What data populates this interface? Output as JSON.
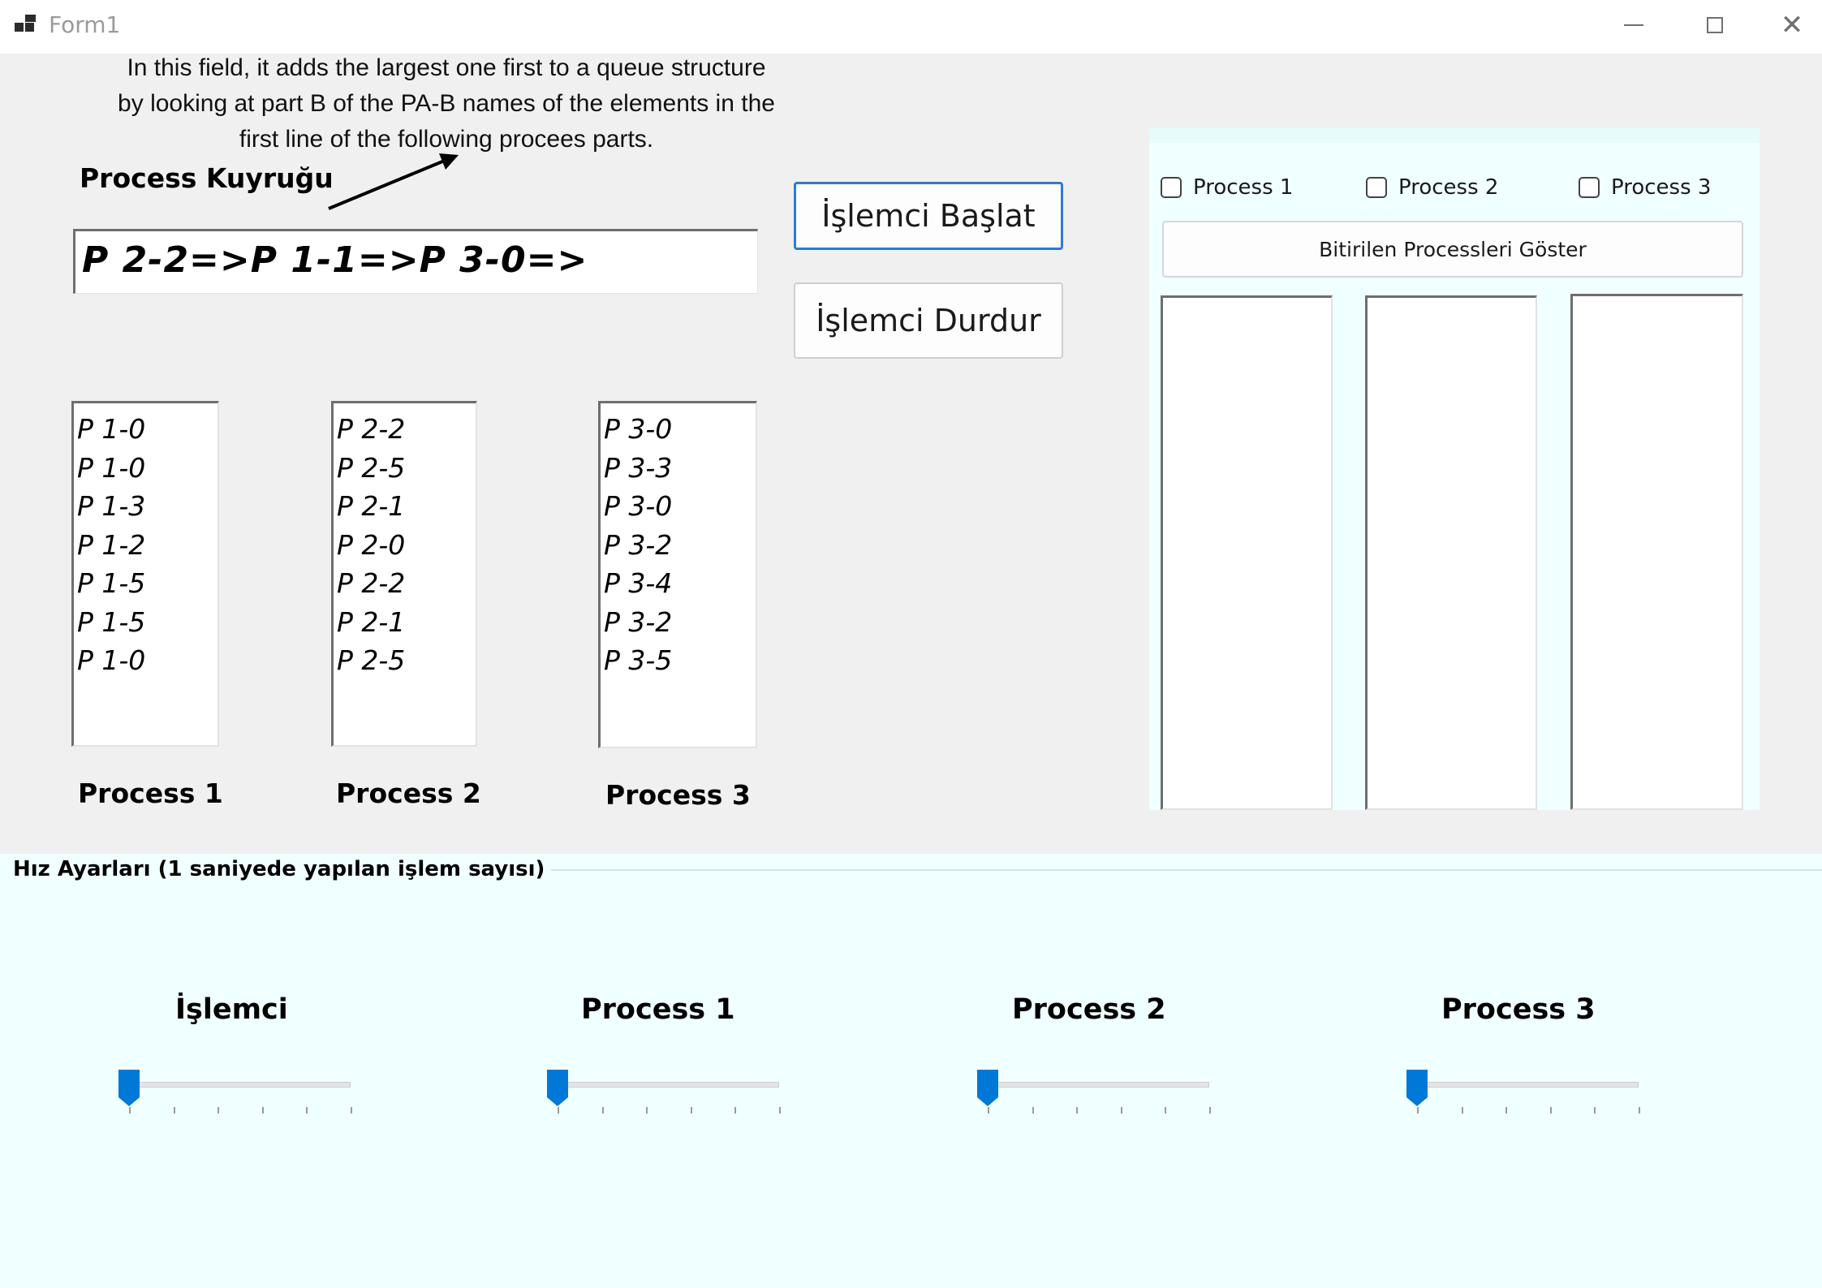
{
  "window": {
    "title": "Form1"
  },
  "annotation": "In this field, it adds the largest one first to a queue structure by looking at part B of the PA-B names of the elements in the first line of the following procees parts.",
  "queue": {
    "label": "Process Kuyruğu",
    "value": "P 2-2=>P 1-1=>P 3-0=>"
  },
  "buttons": {
    "start": "İşlemci Başlat",
    "stop": "İşlemci Durdur",
    "show_finished": "Bitirilen Processleri Göster"
  },
  "processes": [
    {
      "label": "Process 1",
      "items": [
        "P 1-0",
        "P 1-0",
        "P 1-3",
        "P 1-2",
        "P 1-5",
        "P 1-5",
        "P 1-0"
      ]
    },
    {
      "label": "Process 2",
      "items": [
        "P 2-2",
        "P 2-5",
        "P 2-1",
        "P 2-0",
        "P 2-2",
        "P 2-1",
        "P 2-5"
      ]
    },
    {
      "label": "Process 3",
      "items": [
        "P 3-0",
        "P 3-3",
        "P 3-0",
        "P 3-2",
        "P 3-4",
        "P 3-2",
        "P 3-5"
      ]
    }
  ],
  "checkboxes": [
    {
      "label": "Process 1",
      "checked": false
    },
    {
      "label": "Process 2",
      "checked": false
    },
    {
      "label": "Process 3",
      "checked": false
    }
  ],
  "speed": {
    "group_title": "Hız Ayarları (1 saniyede yapılan işlem sayısı)",
    "sliders": [
      {
        "label": "İşlemci",
        "value": 0,
        "max": 5
      },
      {
        "label": "Process 1",
        "value": 0,
        "max": 5
      },
      {
        "label": "Process 2",
        "value": 0,
        "max": 5
      },
      {
        "label": "Process 3",
        "value": 0,
        "max": 5
      }
    ]
  },
  "colors": {
    "accent": "#0078d7",
    "panel_bg": "#f0ffff",
    "window_bg": "#f0f0f0"
  }
}
